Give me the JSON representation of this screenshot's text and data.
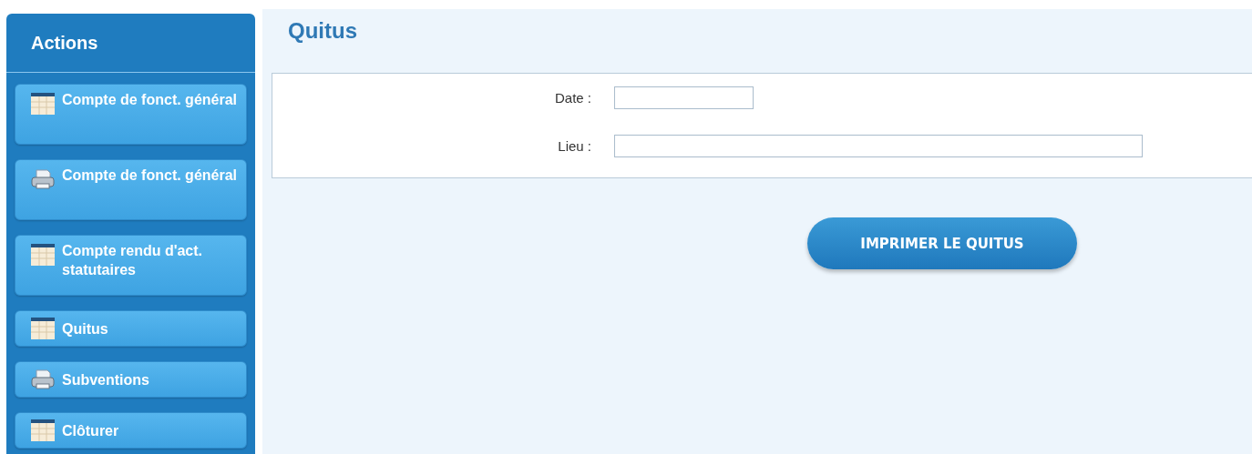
{
  "sidebar": {
    "title": "Actions",
    "items": [
      {
        "kind": "table",
        "label": "Compte de fonct. général"
      },
      {
        "kind": "printer",
        "label": "Compte de fonct. général"
      },
      {
        "kind": "table",
        "label": "Compte rendu d'act. statutaires"
      },
      {
        "kind": "table",
        "label": "Quitus"
      },
      {
        "kind": "printer",
        "label": "Subventions"
      },
      {
        "kind": "table",
        "label": "Clôturer"
      }
    ]
  },
  "page": {
    "title": "Quitus",
    "fields": [
      {
        "kind": "short",
        "label": "Date :"
      },
      {
        "kind": "long",
        "label": "Lieu :"
      }
    ],
    "button": "IMPRIMER LE QUITUS"
  }
}
